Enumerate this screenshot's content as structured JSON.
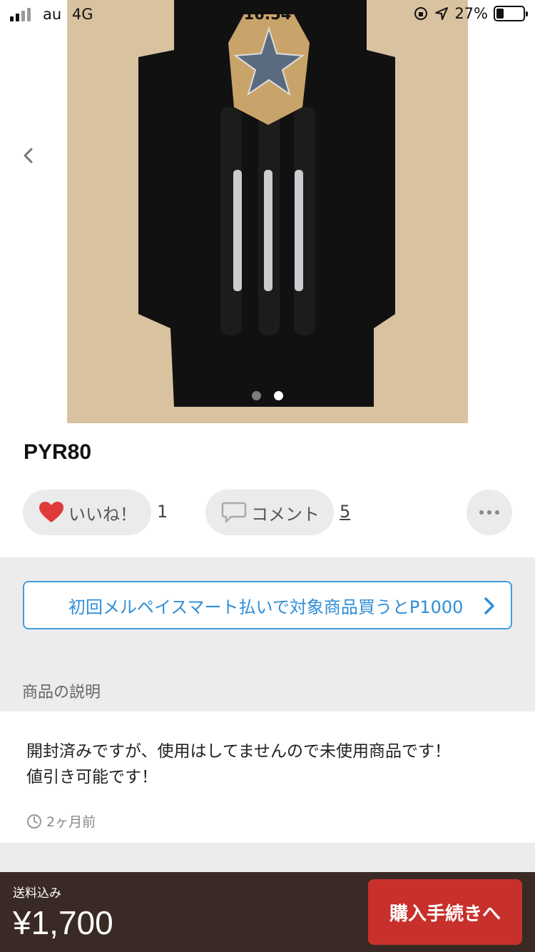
{
  "status_bar": {
    "carrier": "au",
    "network": "4G",
    "time": "16:54",
    "battery_percent": "27%",
    "battery_level": 0.27
  },
  "gallery": {
    "page_count": 2,
    "active_index": 1
  },
  "product": {
    "title": "PYR80",
    "like_label": "いいね！",
    "like_count": "1",
    "comment_label": "コメント",
    "comment_count": "5"
  },
  "promo": {
    "text": "初回メルペイスマート払いで対象商品買うとP1000"
  },
  "description": {
    "section_label": "商品の説明",
    "body": "開封済みですが、使用はしてませんので未使用商品です！\n値引き可能です！",
    "posted": "2ヶ月前"
  },
  "footer": {
    "shipping_label": "送料込み",
    "price": "¥1,700",
    "buy_label": "購入手続きへ"
  },
  "colors": {
    "accent_blue": "#2f8ed8",
    "buy_red": "#c8302b",
    "footer_bg": "#3a2a25",
    "heart_red": "#e03a3a"
  },
  "icons": [
    "back-chevron-icon",
    "prev-image-icon",
    "heart-icon",
    "speech-bubble-icon",
    "more-icon",
    "chevron-right-icon",
    "clock-icon"
  ]
}
